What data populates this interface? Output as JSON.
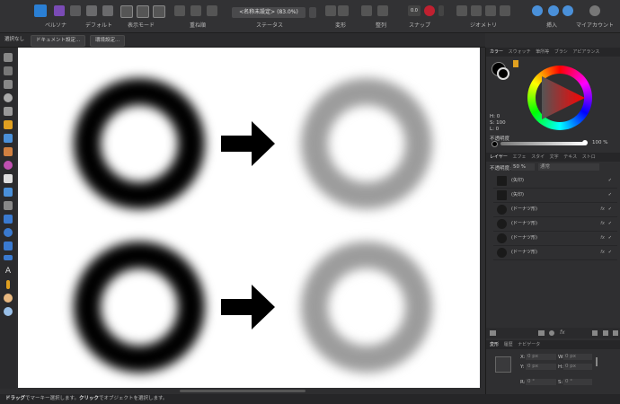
{
  "toolbar": {
    "persona": "ペルソナ",
    "default": "デフォルト",
    "display_mode": "表示モード",
    "overlap": "重ね順",
    "status": "ステータス",
    "status_field": "<名称未設定> (83.0%)",
    "transform": "変形",
    "align": "整列",
    "snap": "スナップ",
    "geometry": "ジオメトリ",
    "insert": "挿入",
    "account": "マイアカウント",
    "snap_value": "0.0"
  },
  "context": {
    "no_selection": "選択なし",
    "document_settings": "ドキュメント設定...",
    "preferences": "環境設定..."
  },
  "panel": {
    "color_tabs": [
      "カラー",
      "スウォッチ",
      "筆所等",
      "ブラシ",
      "アピアランス"
    ],
    "hsl": [
      "H: 0",
      "S: 100",
      "L: 0"
    ],
    "opacity_label": "不透明度",
    "opacity_value": "100 %",
    "layer_tabs": [
      "レイヤー",
      "エフェ",
      "スタイ",
      "文字",
      "テキス",
      "ストロ"
    ],
    "layer_opacity_label": "不透明度:",
    "layer_opacity_value": "50 %",
    "blend_mode": "通常",
    "layers": [
      {
        "name": "(矢印)",
        "fx": false
      },
      {
        "name": "(矢印)",
        "fx": false
      },
      {
        "name": "(ドーナツ形)",
        "fx": true
      },
      {
        "name": "(ドーナツ形)",
        "fx": true
      },
      {
        "name": "(ドーナツ形)",
        "fx": true
      },
      {
        "name": "(ドーナツ形)",
        "fx": true
      }
    ],
    "transform_tabs": [
      "変形",
      "履歴",
      "ナビゲータ"
    ],
    "x": "X:",
    "x_val": "0 px",
    "y": "Y:",
    "y_val": "0 px",
    "w": "W:",
    "w_val": "0 px",
    "h": "H:",
    "h_val": "0 px",
    "r": "R:",
    "r_val": "0 °",
    "s": "S:",
    "s_val": "0 °"
  },
  "statusbar": {
    "drag": "ドラッグ",
    "drag_text": "でマーキー選択します。",
    "click": "クリック",
    "click_text": "でオブジェクトを選択します。"
  },
  "colors": {
    "accent": "#2a7fd4",
    "canvas": "#ffffff",
    "donut_dark": "#000000",
    "donut_light": "#9c9c9c"
  }
}
